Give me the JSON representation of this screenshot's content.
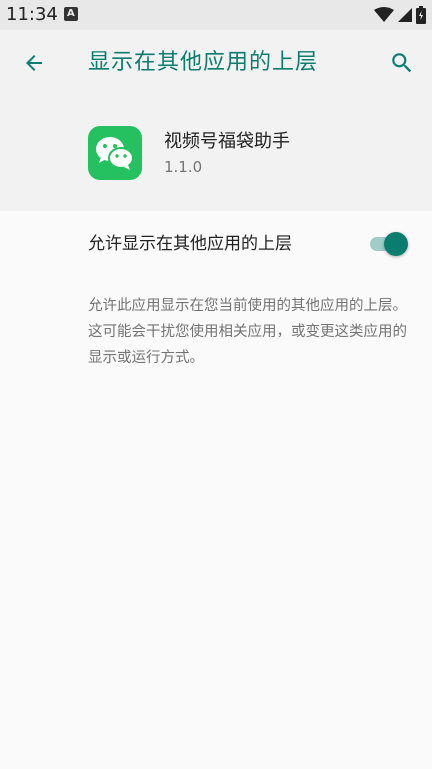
{
  "status_bar": {
    "time": "11:34",
    "notification_icon": "A",
    "icons": [
      "wifi-icon",
      "signal-icon",
      "battery-icon"
    ]
  },
  "app_bar": {
    "back_icon": "arrow-back-icon",
    "title": "显示在其他应用的上层",
    "search_icon": "search-icon"
  },
  "app_info": {
    "icon": "wechat-icon",
    "name": "视频号福袋助手",
    "version": "1.1.0"
  },
  "setting": {
    "label": "允许显示在其他应用的上层",
    "enabled": true,
    "description": "允许此应用显示在您当前使用的其他应用的上层。这可能会干扰您使用相关应用，或变更这类应用的显示或运行方式。"
  },
  "colors": {
    "accent": "#0b7d6e",
    "track": "#9fcdc6",
    "app_icon_bg": "#25c160"
  }
}
